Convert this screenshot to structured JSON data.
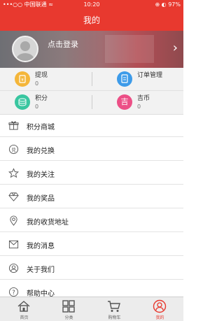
{
  "status_bar": {
    "carrier": "•••○○ 中国联通  ≈",
    "time": "10:20",
    "battery": "⊕ ◐ 97%"
  },
  "nav": {
    "title": "我的"
  },
  "profile": {
    "login_text": "点击登录"
  },
  "stats": [
    {
      "label": "提现",
      "value": "0",
      "icon": "wallet-icon",
      "color": "#f4b63a"
    },
    {
      "label": "订单管理",
      "value": "",
      "icon": "order-icon",
      "color": "#3d9be9"
    },
    {
      "label": "积分",
      "value": "0",
      "icon": "coins-icon",
      "color": "#39c6a0"
    },
    {
      "label": "吉币",
      "value": "0",
      "icon": "ji-coin-icon",
      "color": "#ec4f86",
      "glyph": "吉"
    }
  ],
  "menu": [
    {
      "label": "积分商城",
      "icon": "gift-icon"
    },
    {
      "label": "我的兑换",
      "icon": "exchange-icon"
    },
    {
      "label": "我的关注",
      "icon": "star-icon"
    },
    {
      "label": "我的奖品",
      "icon": "diamond-icon"
    },
    {
      "label": "我的收货地址",
      "icon": "location-icon"
    },
    {
      "label": "我的消息",
      "icon": "message-icon"
    },
    {
      "label": "关于我们",
      "icon": "user-icon"
    },
    {
      "label": "帮助中心",
      "icon": "help-icon"
    }
  ],
  "tabs": [
    {
      "label": "首页",
      "icon": "home-icon"
    },
    {
      "label": "分类",
      "icon": "category-icon"
    },
    {
      "label": "购物车",
      "icon": "cart-icon"
    },
    {
      "label": "我的",
      "icon": "profile-icon",
      "active": true
    }
  ],
  "colors": {
    "accent": "#e8392f"
  }
}
